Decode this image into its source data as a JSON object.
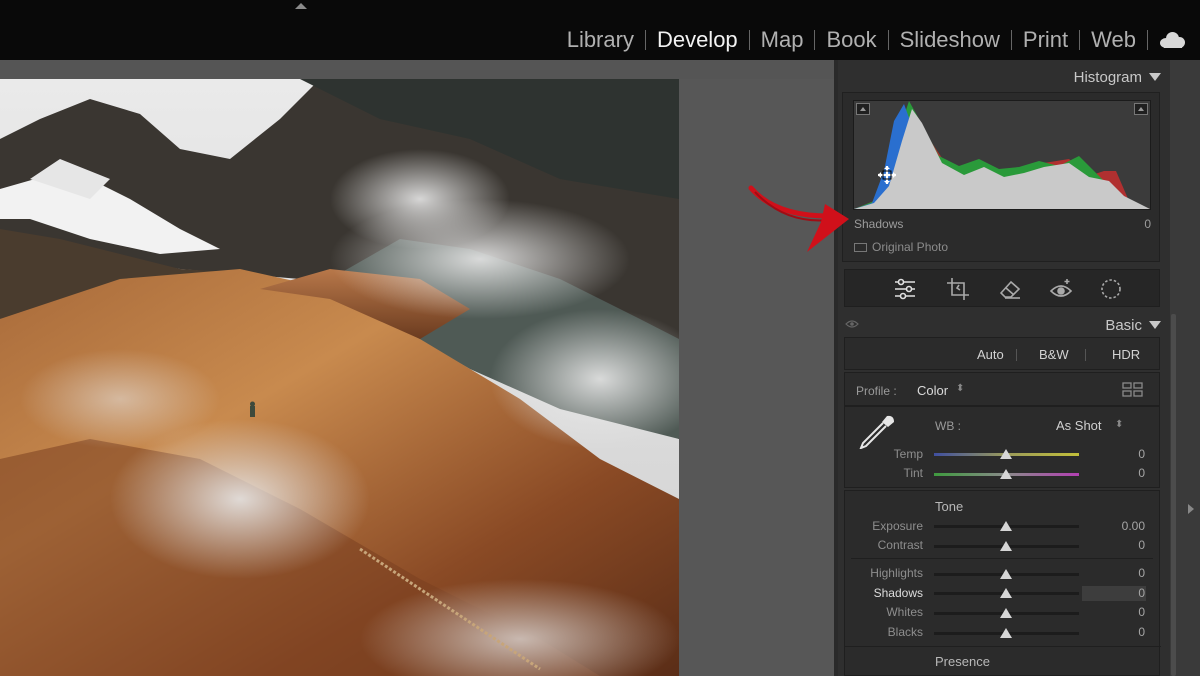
{
  "modules": [
    "Library",
    "Develop",
    "Map",
    "Book",
    "Slideshow",
    "Print",
    "Web"
  ],
  "active_module": "Develop",
  "histogram": {
    "title": "Histogram",
    "hover_label": "Shadows",
    "hover_value": "0",
    "original_photo_label": "Original Photo"
  },
  "tools": [
    "sliders-icon",
    "crop-icon",
    "eraser-icon",
    "redeye-icon",
    "masking-icon"
  ],
  "basic": {
    "title": "Basic",
    "buttons": [
      "Auto",
      "B&W",
      "HDR"
    ],
    "profile_label": "Profile :",
    "profile_value": "Color",
    "wb_label": "WB :",
    "wb_value": "As Shot",
    "temp_label": "Temp",
    "temp_value": "0",
    "tint_label": "Tint",
    "tint_value": "0",
    "tone_title": "Tone",
    "exposure_label": "Exposure",
    "exposure_value": "0.00",
    "contrast_label": "Contrast",
    "contrast_value": "0",
    "highlights_label": "Highlights",
    "highlights_value": "0",
    "shadows_label": "Shadows",
    "shadows_value": "0",
    "whites_label": "Whites",
    "whites_value": "0",
    "blacks_label": "Blacks",
    "blacks_value": "0",
    "presence_title": "Presence"
  },
  "colors": {
    "annotation_arrow": "#d0101a",
    "panel_bg": "#2f2f2f"
  }
}
